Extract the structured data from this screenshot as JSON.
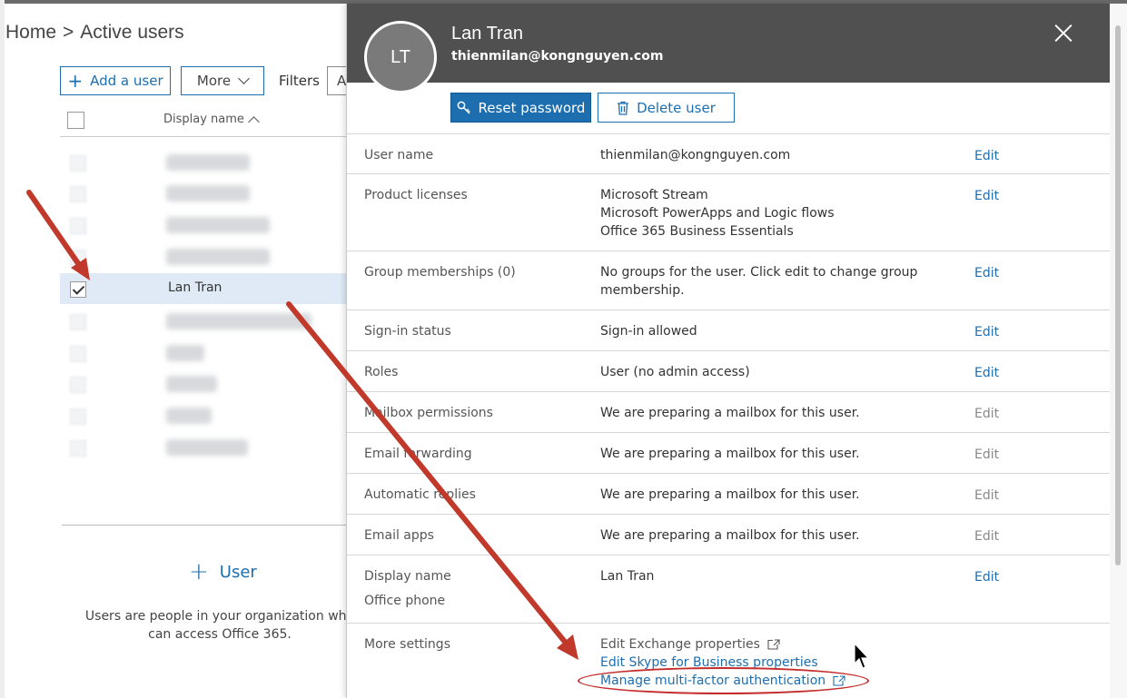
{
  "breadcrumb": {
    "home": "Home",
    "separator": ">",
    "current": "Active users"
  },
  "toolbar": {
    "add_user_label": "Add a user",
    "more_label": "More",
    "filters_label": "Filters",
    "filter_value": "A"
  },
  "list": {
    "header_display_name": "Display name",
    "selected_user": "Lan Tran",
    "add_user_cta": "User",
    "empty_desc_line1": "Users are people in your organization who",
    "empty_desc_line2": "can access Office 365."
  },
  "panel": {
    "avatar_initials": "LT",
    "name": "Lan Tran",
    "email": "thienmilan@kongnguyen.com",
    "reset_password_label": "Reset password",
    "delete_user_label": "Delete user",
    "edit_label": "Edit",
    "properties": {
      "username": {
        "label": "User name",
        "value": "thienmilan@kongnguyen.com"
      },
      "licenses": {
        "label": "Product licenses",
        "values": [
          "Microsoft Stream",
          "Microsoft PowerApps and Logic flows",
          "Office 365 Business Essentials"
        ]
      },
      "groups": {
        "label": "Group memberships (0)",
        "values": [
          "No groups for the user. Click edit to change group",
          "membership."
        ]
      },
      "signin": {
        "label": "Sign-in status",
        "value": "Sign-in allowed"
      },
      "roles": {
        "label": "Roles",
        "value": "User (no admin access)"
      },
      "mailbox": {
        "label": "Mailbox permissions",
        "value": "We are preparing a mailbox for this user."
      },
      "forwarding": {
        "label": "Email forwarding",
        "value": "We are preparing a mailbox for this user."
      },
      "replies": {
        "label": "Automatic replies",
        "value": "We are preparing a mailbox for this user."
      },
      "apps": {
        "label": "Email apps",
        "value": "We are preparing a mailbox for this user."
      },
      "display": {
        "label": "Display name",
        "value": "Lan Tran",
        "sub_label": "Office phone"
      },
      "more": {
        "label": "More settings",
        "exchange": "Edit Exchange properties",
        "skype": "Edit Skype for Business properties",
        "mfa": "Manage multi-factor authentication"
      }
    }
  },
  "colors": {
    "accent": "#1d6eaf",
    "header_bg": "#505050",
    "annotation": "#c0392b",
    "selected_row": "#dfeaf6"
  },
  "icons": [
    "plus-icon",
    "chevron-down-icon",
    "sort-up-icon",
    "checkbox-icon",
    "key-icon",
    "trash-icon",
    "close-icon",
    "external-link-icon",
    "mouse-cursor-icon",
    "annotation-arrow"
  ]
}
